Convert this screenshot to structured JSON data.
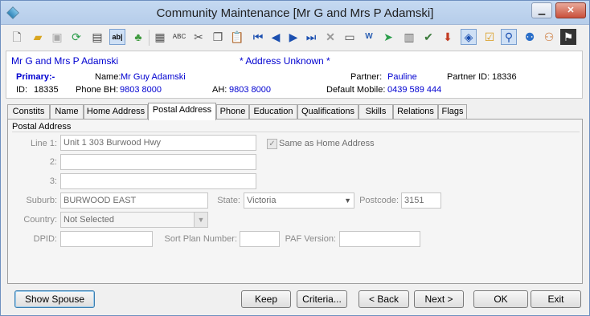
{
  "window": {
    "title": "Community Maintenance  [Mr G and Mrs P Adamski]",
    "minimize": "▁",
    "close": "✕"
  },
  "toolbar": {
    "icons": [
      "new-icon",
      "open-icon",
      "save-icon",
      "refresh-icon",
      "print-icon",
      "text-field-icon",
      "tree-icon",
      "calculator-icon",
      "spellcheck-icon",
      "cut-icon",
      "copy-icon",
      "paste-icon",
      "first-record-icon",
      "previous-record-icon",
      "next-record-icon",
      "last-record-icon",
      "delete-icon",
      "card-icon",
      "word-doc-icon",
      "forward-icon",
      "clipboard-icon",
      "stamp-icon",
      "download-icon",
      "tag-icon",
      "checklist-icon",
      "pin-icon",
      "people-icon",
      "group-icon",
      "flag-icon"
    ]
  },
  "header": {
    "display_name": "Mr G and Mrs P Adamski",
    "address_notice": "* Address Unknown *",
    "primary_label": "Primary:-",
    "name_label": "Name:",
    "name_value": "Mr Guy Adamski",
    "partner_label": "Partner:",
    "partner_value": "Pauline",
    "partner_id_label": "Partner ID:",
    "partner_id_value": "18336",
    "id_label": "ID:",
    "id_value": "18335",
    "phone_bh_label": "Phone BH:",
    "phone_bh_value": "9803 8000",
    "ah_label": "AH:",
    "ah_value": "9803 8000",
    "mobile_label": "Default Mobile:",
    "mobile_value": "0439 589 444"
  },
  "tabs": [
    "Constits",
    "Name",
    "Home Address",
    "Postal Address",
    "Phone",
    "Education",
    "Qualifications",
    "Skills",
    "Relations",
    "Flags"
  ],
  "active_tab": "Postal Address",
  "postal": {
    "group_title": "Postal Address",
    "line1_label": "Line 1:",
    "line1_value": "Unit 1 303 Burwood Hwy",
    "line2_label": "2:",
    "line2_value": "",
    "line3_label": "3:",
    "line3_value": "",
    "same_as_home_label": "Same as Home Address",
    "same_as_home_checked": true,
    "suburb_label": "Suburb:",
    "suburb_value": "BURWOOD EAST",
    "state_label": "State:",
    "state_value": "Victoria",
    "postcode_label": "Postcode:",
    "postcode_value": "3151",
    "country_label": "Country:",
    "country_value": "Not Selected",
    "dpid_label": "DPID:",
    "dpid_value": "",
    "sort_plan_label": "Sort Plan Number:",
    "sort_plan_value": "",
    "paf_label": "PAF Version:",
    "paf_value": ""
  },
  "buttons": {
    "show_spouse": "Show Spouse",
    "keep": "Keep",
    "criteria": "Criteria...",
    "back": "< Back",
    "next": "Next >",
    "ok": "OK",
    "exit": "Exit"
  },
  "colors": {
    "link_blue": "#0000d0",
    "title_bar": "#c5d9f1"
  }
}
